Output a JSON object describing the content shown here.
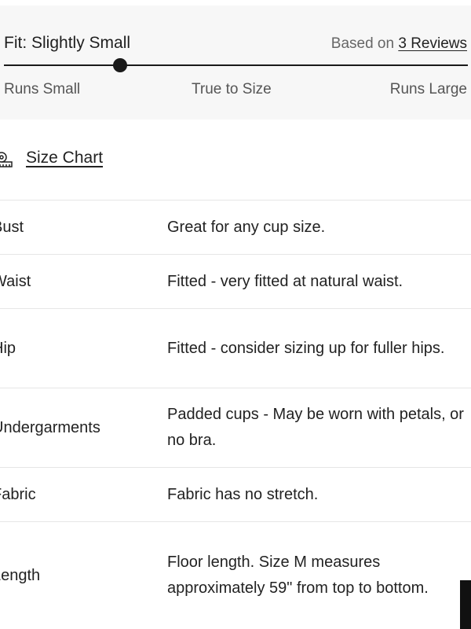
{
  "fit": {
    "title": "Fit: Slightly Small",
    "based_on_prefix": "Based on ",
    "reviews_link": "3 Reviews",
    "scale": {
      "left": "Runs Small",
      "middle": "True to Size",
      "right": "Runs Large"
    },
    "position_fraction": 0.25
  },
  "size_chart": {
    "icon": "ruler-icon",
    "label": "Size Chart"
  },
  "attributes": [
    {
      "label": "Bust",
      "value": "Great for any cup size."
    },
    {
      "label": "Waist",
      "value": "Fitted - very fitted at natural waist."
    },
    {
      "label": "Hip",
      "value": "Fitted - consider sizing up for fuller hips."
    },
    {
      "label": "Undergarments",
      "value": "Padded cups - May be worn with petals, or no bra."
    },
    {
      "label": "Fabric",
      "value": "Fabric has no stretch."
    },
    {
      "label": "Length",
      "value": "Floor length. Size M measures approximately 59\" from top to bottom."
    }
  ],
  "colors": {
    "panel_bg": "#f7f7f7",
    "text": "#222222",
    "muted_text": "#666666",
    "divider": "#e6e6e6",
    "slider": "#1a1a1a"
  }
}
